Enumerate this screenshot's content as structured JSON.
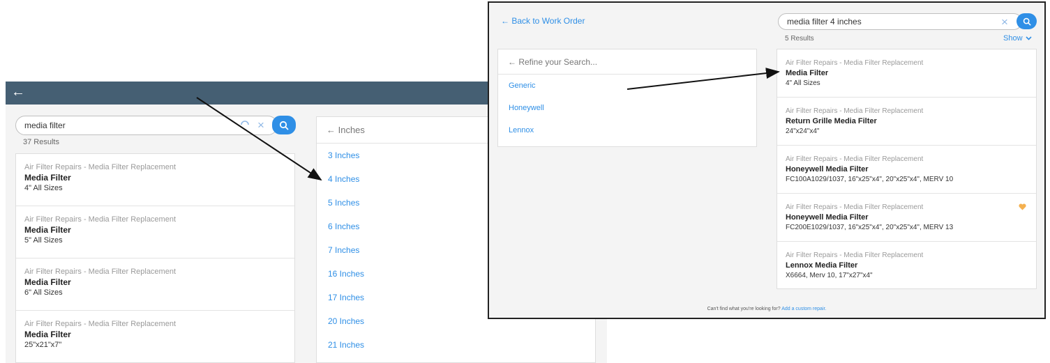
{
  "background": {
    "header": {
      "back_icon": "arrow-left-icon",
      "back_glyph": "←"
    },
    "search": {
      "value": "media filter",
      "clear_glyph": "×",
      "result_count": "37 Results"
    },
    "results": [
      {
        "category": "Air Filter Repairs - Media Filter Replacement",
        "title": "Media Filter",
        "detail": "4\" All Sizes"
      },
      {
        "category": "Air Filter Repairs - Media Filter Replacement",
        "title": "Media Filter",
        "detail": "5\" All Sizes"
      },
      {
        "category": "Air Filter Repairs - Media Filter Replacement",
        "title": "Media Filter",
        "detail": "6\" All Sizes"
      },
      {
        "category": "Air Filter Repairs - Media Filter Replacement",
        "title": "Media Filter",
        "detail": "25\"x21\"x7\""
      }
    ],
    "inches_panel": {
      "header": "← Inches",
      "items": [
        "3 Inches",
        "4 Inches",
        "5 Inches",
        "6 Inches",
        "7 Inches",
        "16 Inches",
        "17 Inches",
        "20 Inches",
        "21 Inches"
      ]
    }
  },
  "overlay": {
    "back_link": "← Back to Work Order",
    "search": {
      "value": "media filter 4 inches",
      "clear_glyph": "×",
      "result_count": "5 Results"
    },
    "show_label": "Show",
    "refine": {
      "header": "← Refine your Search...",
      "items": [
        "Generic",
        "Honeywell",
        "Lennox"
      ]
    },
    "results": [
      {
        "category": "Air Filter Repairs - Media Filter Replacement",
        "title": "Media Filter",
        "detail": "4\" All Sizes"
      },
      {
        "category": "Air Filter Repairs - Media Filter Replacement",
        "title": "Return Grille Media Filter",
        "detail": "24\"x24\"x4\""
      },
      {
        "category": "Air Filter Repairs - Media Filter Replacement",
        "title": "Honeywell Media Filter",
        "detail": "FC100A1029/1037, 16\"x25\"x4\", 20\"x25\"x4\", MERV 10"
      },
      {
        "category": "Air Filter Repairs - Media Filter Replacement",
        "title": "Honeywell Media Filter",
        "detail": "FC200E1029/1037, 16\"x25\"x4\", 20\"x25\"x4\", MERV 13",
        "favorite": true
      },
      {
        "category": "Air Filter Repairs - Media Filter Replacement",
        "title": "Lennox Media Filter",
        "detail": "X6664, Merv 10, 17\"x27\"x4\""
      }
    ],
    "footer": {
      "text": "Can't find what you're looking for? ",
      "link": "Add a custom repair."
    }
  },
  "colors": {
    "header": "#455f73",
    "accent": "#2f8fe6",
    "favorite": "#f4b04f"
  },
  "icons": [
    "arrow-left-icon",
    "search-icon",
    "close-icon",
    "chevron-down-icon",
    "heart-icon",
    "annotation-arrow-icon"
  ]
}
